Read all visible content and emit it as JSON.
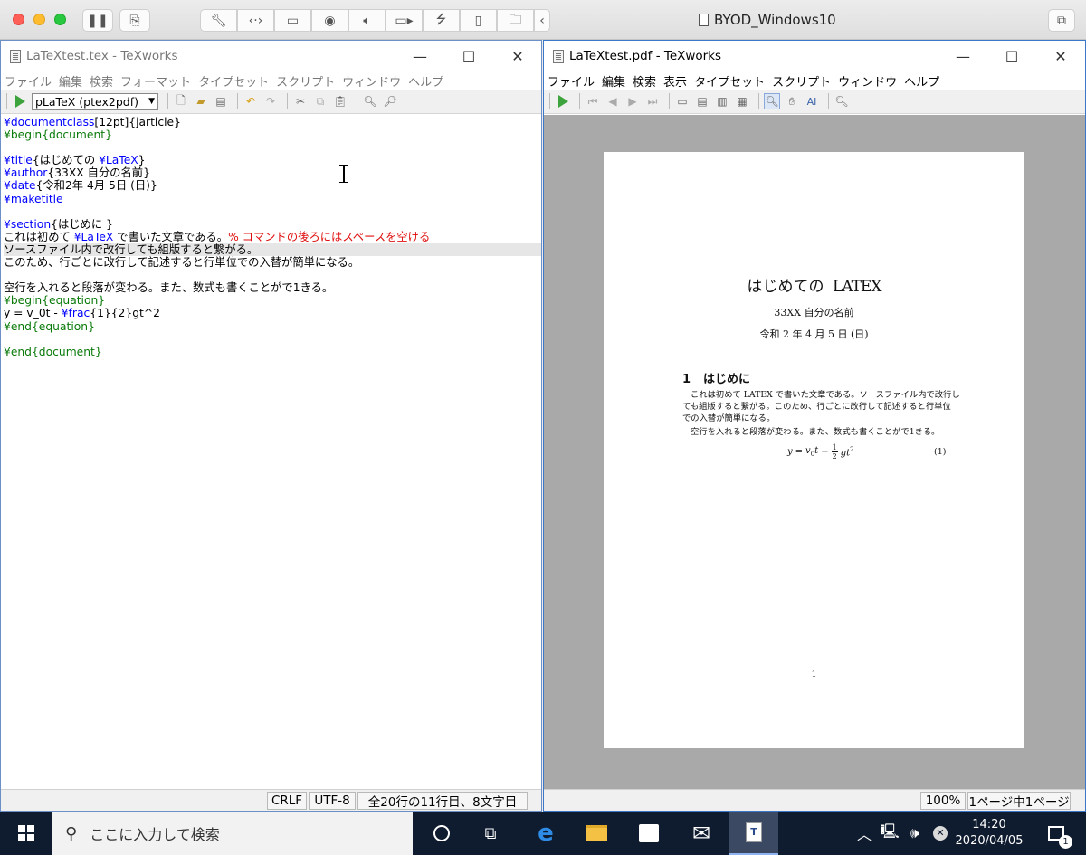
{
  "mac": {
    "vm_title": "BYOD_Windows10",
    "toolbar_icons": [
      "wrench-icon",
      "code-icon",
      "drive-icon",
      "webcam-icon",
      "audio-icon",
      "camera-icon",
      "usb-icon",
      "phone-icon",
      "shared-folder-icon"
    ]
  },
  "editor_window": {
    "title": "LaTeXtest.tex - TeXworks",
    "menu": [
      "ファイル",
      "編集",
      "検索",
      "フォーマット",
      "タイプセット",
      "スクリプト",
      "ウィンドウ",
      "ヘルプ"
    ],
    "engine": "pLaTeX (ptex2pdf)",
    "status": {
      "line_ending": "CRLF",
      "encoding": "UTF-8",
      "position": "全20行の11行目、8文字目"
    }
  },
  "source_lines": [
    [
      {
        "t": "¥documentclass",
        "c": "cmd"
      },
      {
        "t": "[12pt]{jarticle}",
        "c": ""
      }
    ],
    [
      {
        "t": "¥begin{document}",
        "c": "env"
      }
    ],
    [],
    [
      {
        "t": "¥title",
        "c": "cmd"
      },
      {
        "t": "{はじめての ",
        "c": ""
      },
      {
        "t": "¥LaTeX",
        "c": "cmd"
      },
      {
        "t": "}",
        "c": ""
      }
    ],
    [
      {
        "t": "¥author",
        "c": "cmd"
      },
      {
        "t": "{33XX 自分の名前}",
        "c": ""
      }
    ],
    [
      {
        "t": "¥date",
        "c": "cmd"
      },
      {
        "t": "{令和2年 4月 5日 (日)}",
        "c": ""
      }
    ],
    [
      {
        "t": "¥maketitle",
        "c": "cmd"
      }
    ],
    [],
    [
      {
        "t": "¥section",
        "c": "cmd"
      },
      {
        "t": "{はじめに }",
        "c": ""
      }
    ],
    [
      {
        "t": "これは初めて ",
        "c": ""
      },
      {
        "t": "¥LaTeX",
        "c": "cmd"
      },
      {
        "t": " で書いた文章である。",
        "c": ""
      },
      {
        "t": "% コマンドの後ろにはスペースを空ける",
        "c": "cmt"
      }
    ],
    [
      {
        "t": "ソースファイル内で改行しても組版すると繋がる。",
        "c": ""
      }
    ],
    [
      {
        "t": "このため、行ごとに改行して記述すると行単位での入替が簡単になる。",
        "c": ""
      }
    ],
    [],
    [
      {
        "t": "空行を入れると段落が変わる。また、数式も書くことがで1きる。",
        "c": ""
      }
    ],
    [
      {
        "t": "¥begin{equation}",
        "c": "env"
      }
    ],
    [
      {
        "t": "y = v_0t - ",
        "c": ""
      },
      {
        "t": "¥frac",
        "c": "cmd"
      },
      {
        "t": "{1}{2}gt^2",
        "c": ""
      }
    ],
    [
      {
        "t": "¥end{equation}",
        "c": "env"
      }
    ],
    [],
    [
      {
        "t": "¥end{document}",
        "c": "env"
      }
    ]
  ],
  "pdf_window": {
    "title": "LaTeXtest.pdf - TeXworks",
    "menu": [
      "ファイル",
      "編集",
      "検索",
      "表示",
      "タイプセット",
      "スクリプト",
      "ウィンドウ",
      "ヘルプ"
    ],
    "status": {
      "zoom": "100%",
      "page": "1ページ中1ページ"
    }
  },
  "pdf_page": {
    "title_prefix": "はじめての",
    "title_latex": "LATEX",
    "author": "33XX 自分の名前",
    "date": "令和 2 年 4 月 5 日 (日)",
    "section_number": "1",
    "section_title": "はじめに",
    "paragraph1": "これは初めて LATEX で書いた文章である。ソースファイル内で改行しても組版すると繋がる。このため、行ごとに改行して記述すると行単位での入替が簡単になる。",
    "paragraph1_lines": [
      "これは初めて LATEX で書いた文章である。ソースファイル内で改行し",
      "ても組版すると繋がる。このため、行ごとに改行して記述すると行単位",
      "での入替が簡単になる。"
    ],
    "paragraph2": "空行を入れると段落が変わる。また、数式も書くことがで1きる。",
    "equation_number": "(1)",
    "page_number": "1"
  },
  "taskbar": {
    "search_placeholder": "ここに入力して検索",
    "time": "14:20",
    "date": "2020/04/05",
    "notification_count": "1"
  }
}
